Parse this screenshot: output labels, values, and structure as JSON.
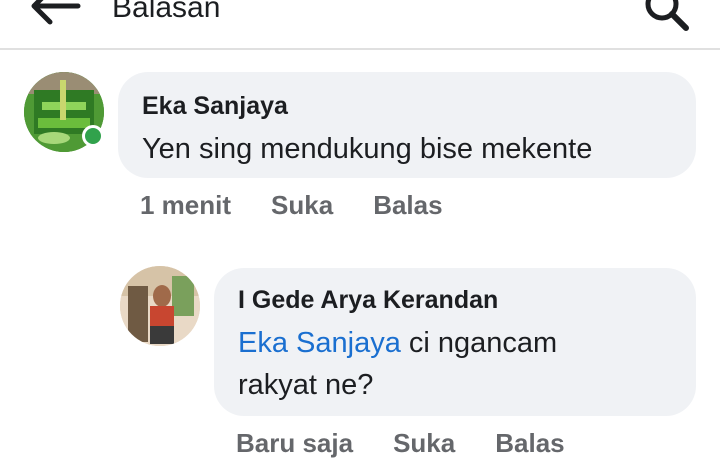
{
  "header": {
    "title": "Balasan",
    "back_icon": "arrow-left-icon",
    "search_icon": "search-icon"
  },
  "comments": [
    {
      "author": "Eka Sanjaya",
      "text": "Yen sing mendukung bise mekente",
      "time": "1 menit",
      "like_label": "Suka",
      "reply_label": "Balas",
      "online": true
    },
    {
      "author": "I Gede Arya Kerandan",
      "mention": "Eka Sanjaya",
      "text_line1": " ci ngancam",
      "text_line2": "rakyat ne?",
      "time": "Baru saja",
      "like_label": "Suka",
      "reply_label": "Balas"
    }
  ],
  "colors": {
    "bubble": "#f0f2f5",
    "mention": "#1a6fd0",
    "meta": "#65676b",
    "online": "#31a24c"
  }
}
